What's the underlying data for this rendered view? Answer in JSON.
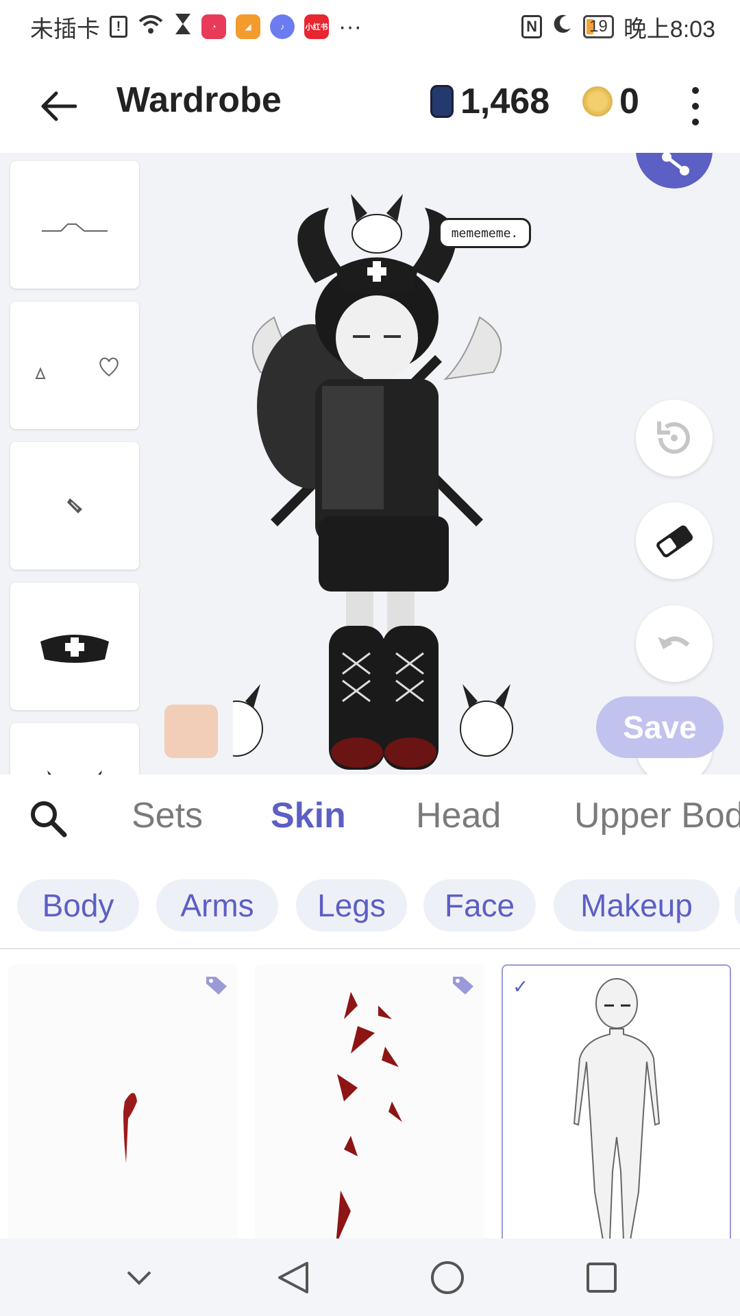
{
  "status_bar": {
    "carrier": "未插卡",
    "apps": [
      {
        "name": "app-1",
        "color": "#e83b5a"
      },
      {
        "name": "app-2",
        "color": "#f39b2c"
      },
      {
        "name": "app-3",
        "color": "#6c7cf0"
      },
      {
        "name": "xiaohongshu",
        "label": "小红书",
        "color": "#e8262f"
      }
    ],
    "more": "···",
    "battery": "19",
    "time": "晚上8:03"
  },
  "app_bar": {
    "title": "Wardrobe",
    "gems": "1,468",
    "coins": "0"
  },
  "preview": {
    "speech_bubble": "memememe.",
    "save_label": "Save",
    "skin_color": "#f2cdb8"
  },
  "tabs": [
    {
      "label": "Sets",
      "active": false
    },
    {
      "label": "Skin",
      "active": true
    },
    {
      "label": "Head",
      "active": false
    },
    {
      "label": "Upper Body",
      "active": false
    }
  ],
  "subtabs": [
    "Body",
    "Arms",
    "Legs",
    "Face",
    "Makeup"
  ],
  "colors": {
    "accent": "#5c5fc4",
    "save_disabled": "#c1c2ee",
    "chip_bg": "#eef0f7"
  }
}
